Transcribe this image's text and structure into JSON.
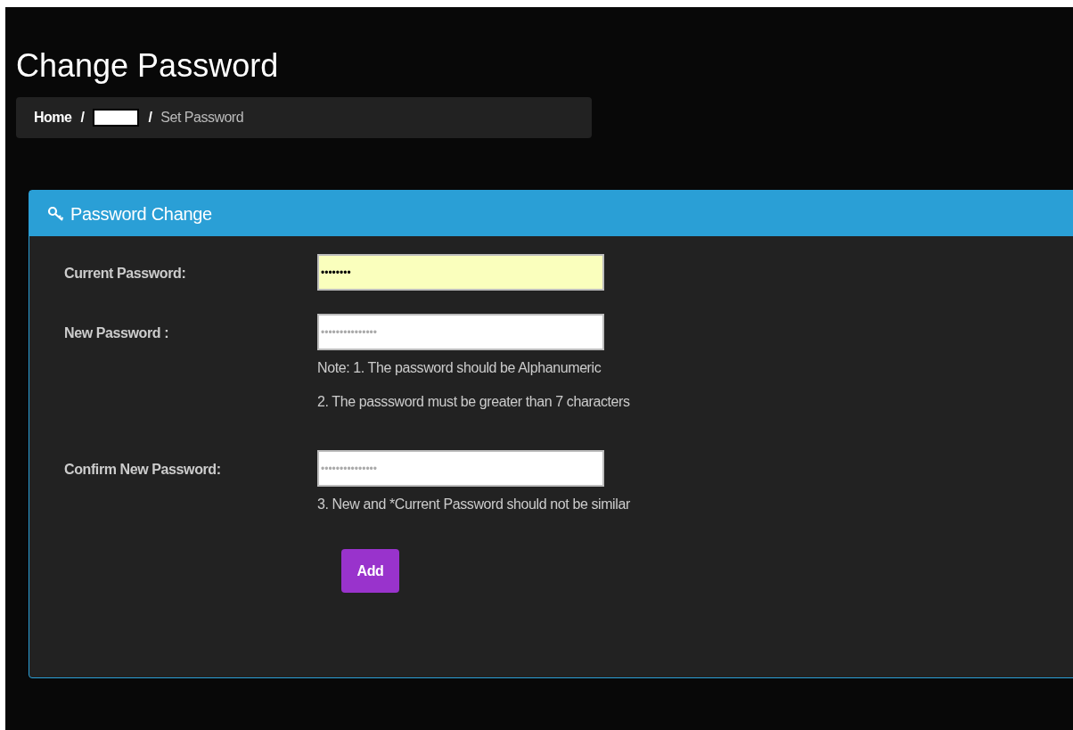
{
  "page_title": "Change Password",
  "breadcrumb": {
    "home": "Home",
    "separators": [
      "/",
      "/"
    ],
    "current": "Set Password"
  },
  "panel": {
    "title": "Password Change",
    "fields": [
      {
        "label": "Current Password:",
        "value": "••••••••",
        "autofilled": true
      },
      {
        "label": "New Password :",
        "placeholder": "•••••••••••••••",
        "autofilled": false,
        "notes": [
          "Note: 1. The password should be Alphanumeric",
          "2. The passsword must be greater than 7 characters"
        ]
      },
      {
        "label": "Confirm New Password:",
        "placeholder": "•••••••••••••••",
        "autofilled": false,
        "notes": [
          "3. New and *Current Password should not be similar"
        ]
      }
    ],
    "button": "Add"
  }
}
